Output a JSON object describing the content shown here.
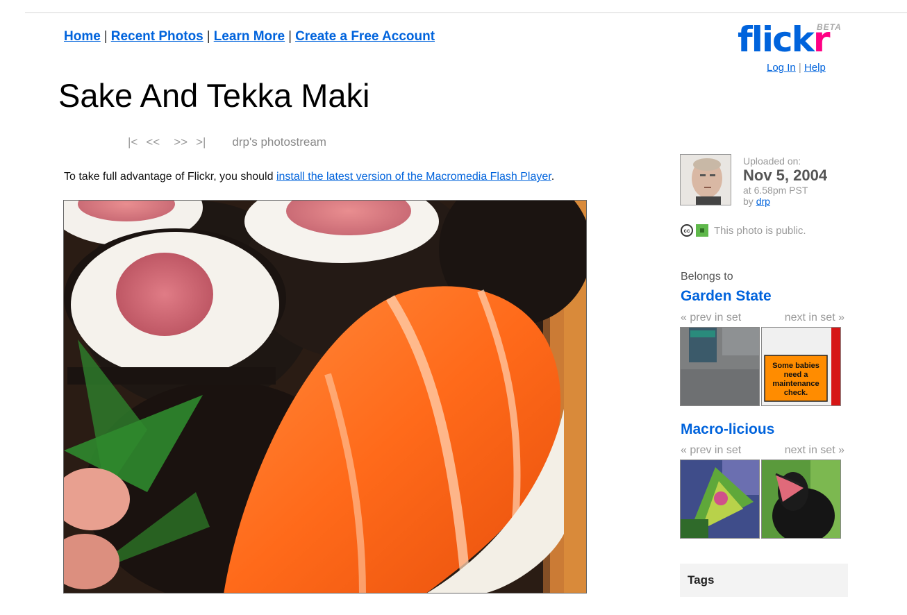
{
  "nav": {
    "home": "Home",
    "recent": "Recent Photos",
    "learn": "Learn More",
    "create": "Create a Free Account",
    "sep": "|"
  },
  "logo": {
    "text_a": "flick",
    "text_b": "r",
    "beta": "BETA"
  },
  "auth": {
    "login": "Log In",
    "sep": "|",
    "help": "Help"
  },
  "photo": {
    "title": "Sake And Tekka Maki"
  },
  "pager": {
    "first": "|<",
    "prev": "<<",
    "next": ">>",
    "last": ">|",
    "stream": "drp's photostream"
  },
  "flash": {
    "prefix": "To take full advantage of Flickr, you should ",
    "link": "install the latest version of the Macromedia Flash Player",
    "suffix": "."
  },
  "upload": {
    "label": "Uploaded on:",
    "date": "Nov 5, 2004",
    "time": "at 6.58pm PST",
    "by_prefix": "by ",
    "user": "drp"
  },
  "privacy": {
    "cc": "cc",
    "text": "This photo is public."
  },
  "sets": {
    "belongs_label": "Belongs to",
    "items": [
      {
        "name": "Garden State",
        "prev": "« prev in set",
        "next": "next in set »",
        "sign_text": "Some babies need a maintenance check."
      },
      {
        "name": "Macro-licious",
        "prev": "« prev in set",
        "next": "next in set »"
      }
    ]
  },
  "tags": {
    "heading": "Tags"
  },
  "colors": {
    "link": "#0063dc",
    "flickr_pink": "#ff0084",
    "public_green": "#5fb84b"
  }
}
